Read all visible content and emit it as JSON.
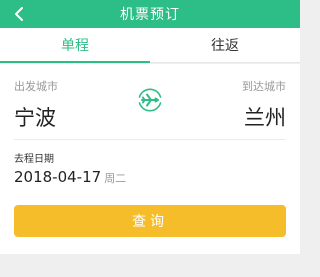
{
  "navbar": {
    "title": "机票预订",
    "back_icon": "chevron-left-icon"
  },
  "tabs": [
    {
      "label": "单程",
      "active": true
    },
    {
      "label": "往返",
      "active": false
    }
  ],
  "route": {
    "from_label": "出发城市",
    "from_city": "宁波",
    "to_label": "到达城市",
    "to_city": "兰州",
    "swap_icon": "airplane-swap-icon"
  },
  "date": {
    "label": "去程日期",
    "value": "2018-04-17",
    "weekday": "周二"
  },
  "search_button": {
    "label": "查询"
  },
  "colors": {
    "brand_green": "#2dbd86",
    "button_yellow": "#f6bd2b",
    "background": "#efefef"
  }
}
